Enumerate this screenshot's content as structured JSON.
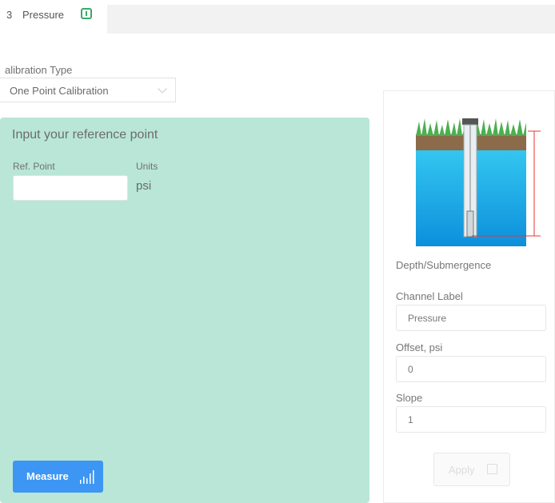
{
  "tab": {
    "number": "3",
    "label": "Pressure",
    "info_icon": "info-icon"
  },
  "calibration": {
    "type_label": "alibration Type",
    "selected": "One Point Calibration"
  },
  "reference_panel": {
    "title": "Input your reference point",
    "ref_point_label": "Ref. Point",
    "ref_point_value": "",
    "units_label": "Units",
    "units_value": "psi",
    "measure_label": "Measure",
    "measure_icon": "bar-chart-icon",
    "background_color": "#b9e6d7",
    "button_color": "#3d96f3"
  },
  "sensor_panel": {
    "diagram_caption": "Depth/Submergence",
    "channel_label_title": "Channel Label",
    "channel_label_value": "Pressure",
    "offset_title": "Offset, psi",
    "offset_value": "0",
    "slope_title": "Slope",
    "slope_value": "1",
    "apply_label": "Apply",
    "apply_icon": "external-link-icon"
  }
}
